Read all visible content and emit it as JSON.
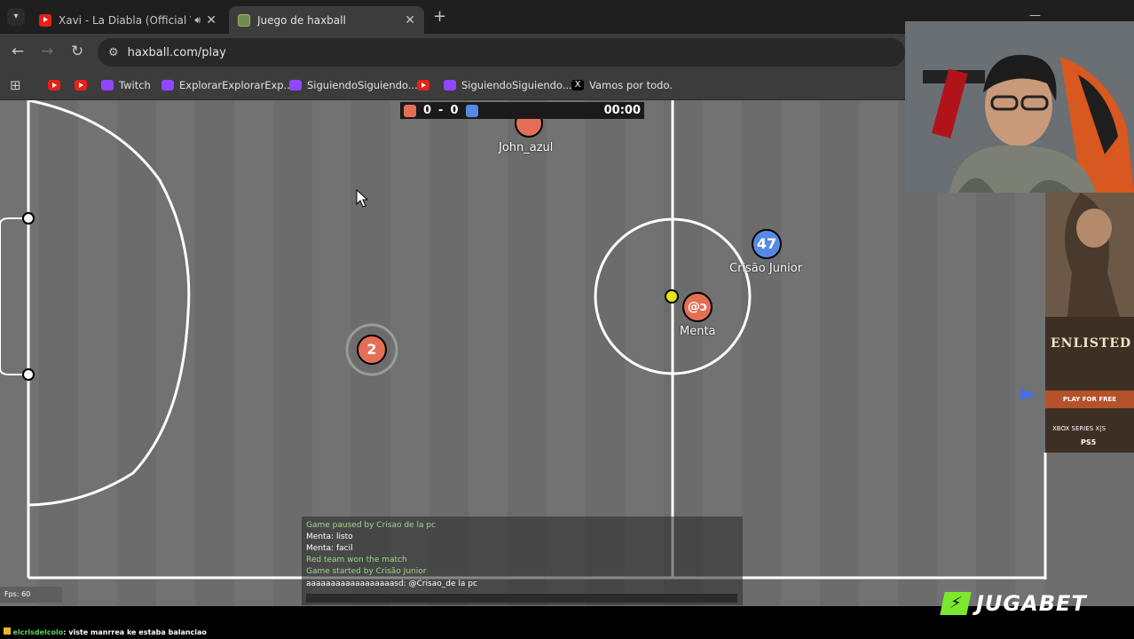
{
  "tabs": [
    {
      "title": "Xavi - La Diabla (Official Vid",
      "favicon": "youtube-icon",
      "audio": true
    },
    {
      "title": "Juego de haxball",
      "favicon": "haxball-icon"
    }
  ],
  "toolbar": {
    "url": "haxball.com/play"
  },
  "bookmarks": [
    {
      "label": "",
      "icon": "youtube-icon"
    },
    {
      "label": "",
      "icon": "youtube-icon"
    },
    {
      "label": "Twitch",
      "icon": "twitch-icon"
    },
    {
      "label": "ExplorarExplorarExp...",
      "icon": "twitch-icon"
    },
    {
      "label": "SiguiendoSiguiendo...",
      "icon": "twitch-icon"
    },
    {
      "label": "",
      "icon": "youtube-icon"
    },
    {
      "label": "SiguiendoSiguiendo...",
      "icon": "twitch-icon"
    },
    {
      "label": "Vamos por todo.",
      "icon": "x-icon"
    }
  ],
  "score": {
    "red": "0",
    "sep": "-",
    "blue": "0",
    "time": "00:00",
    "red_color": "#e56e56",
    "blue_color": "#5689e5"
  },
  "players": [
    {
      "name": "John_azul",
      "avatar": "",
      "team": "red"
    },
    {
      "name": "Crisão Junior",
      "avatar": "47",
      "team": "blue"
    },
    {
      "name": "Menta",
      "avatar": "@ɔ",
      "team": "red"
    },
    {
      "name": "",
      "avatar": "2",
      "team": "red"
    }
  ],
  "chat": {
    "lines": [
      {
        "text": "Game paused by Crisao de la pc",
        "type": "system"
      },
      {
        "text": "Menta: listo",
        "type": "message"
      },
      {
        "text": "Menta: facil",
        "type": "message"
      },
      {
        "text": "Red team won the match",
        "type": "system"
      },
      {
        "text": "Game started by Crisão Junior",
        "type": "system"
      },
      {
        "text": "aaaaaaaaaaaaaaaaaasd: @Crisao_de la pc",
        "type": "message"
      }
    ]
  },
  "fps": "Fps: 60",
  "overlay": {
    "ad_title": "ENLISTED",
    "ad_button": "PLAY FOR FREE",
    "ad_platform_1": "XBOX SERIES X|S",
    "ad_platform_2": "PS5",
    "sponsor": "JUGABET",
    "twitch_chat_user": "elcrisdelcolo",
    "twitch_chat_text": ": viste manrrea ke estaba balanciao"
  }
}
